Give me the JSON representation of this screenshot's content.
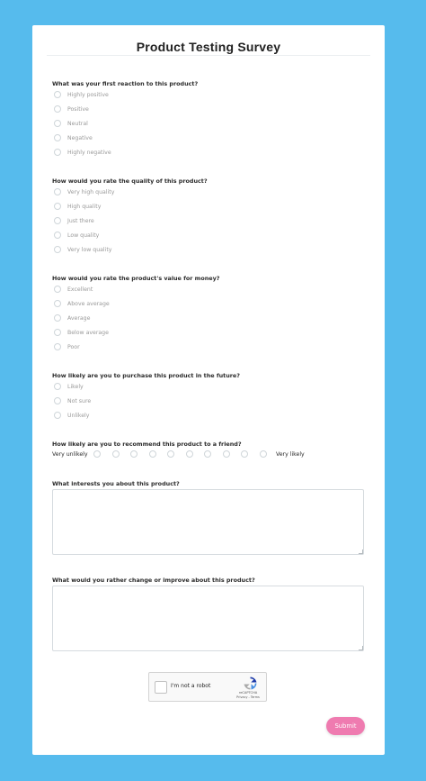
{
  "survey": {
    "title": "Product Testing Survey",
    "questions": [
      {
        "label": "What was your first reaction to this product?",
        "options": [
          "Highly positive",
          "Positive",
          "Neutral",
          "Negative",
          "Highly negative"
        ]
      },
      {
        "label": "How would you rate the quality of this product?",
        "options": [
          "Very high quality",
          "High quality",
          "Just there",
          "Low quality",
          "Very low quality"
        ]
      },
      {
        "label": "How would you rate the product's value for money?",
        "options": [
          "Excellent",
          "Above average",
          "Average",
          "Below average",
          "Poor"
        ]
      },
      {
        "label": "How likely are you to purchase this product in the future?",
        "options": [
          "Likely",
          "Not sure",
          "Unlikely"
        ]
      }
    ],
    "recommend": {
      "label": "How likely are you to recommend this product to a friend?",
      "low": "Very unlikely",
      "high": "Very likely",
      "points": 10
    },
    "interests": {
      "label": "What interests you about this product?",
      "value": ""
    },
    "improve": {
      "label": "What would you rather change or improve about this product?",
      "value": ""
    },
    "captcha": {
      "label": "I'm not a robot",
      "brand": "reCAPTCHA",
      "terms": "Privacy - Terms"
    },
    "submit_label": "Submit"
  },
  "colors": {
    "background": "#56bbed",
    "submit": "#ef7bb0"
  }
}
